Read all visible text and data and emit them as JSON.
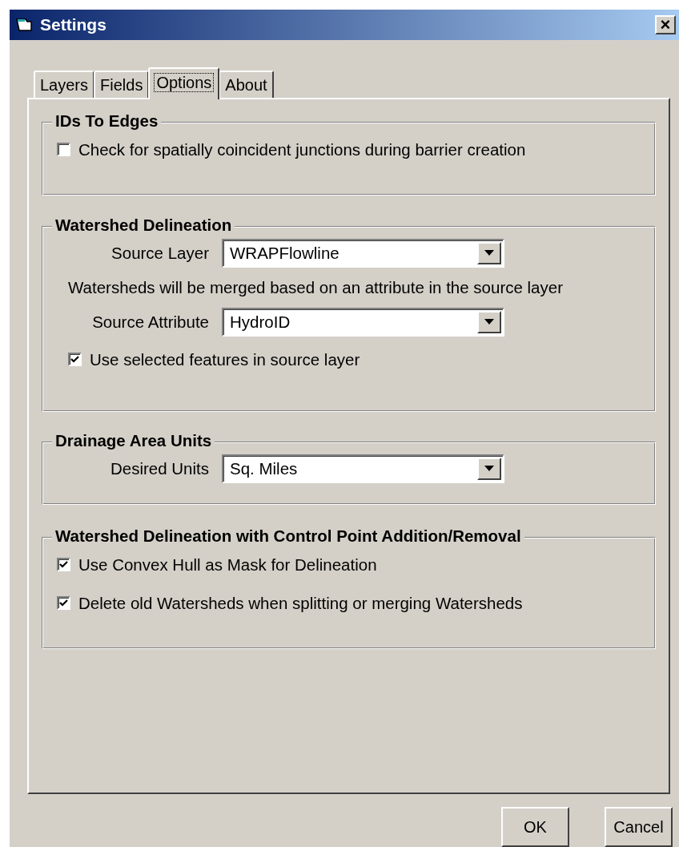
{
  "window": {
    "title": "Settings",
    "close": "×"
  },
  "tabs": [
    {
      "label": "Layers",
      "selected": false
    },
    {
      "label": "Fields",
      "selected": false
    },
    {
      "label": "Options",
      "selected": true
    },
    {
      "label": "About",
      "selected": false
    }
  ],
  "groups": [
    {
      "title": "IDs To Edges",
      "items": [
        {
          "kind": "check",
          "label": "Check for spatially coincident junctions during barrier creation",
          "checked": false
        }
      ]
    },
    {
      "title": "Watershed Delineation",
      "items": [
        {
          "kind": "combo",
          "label": "Source Layer",
          "value": "WRAPFlowline"
        },
        {
          "kind": "note",
          "label": "Watersheds will be merged based on an attribute in the source layer"
        },
        {
          "kind": "combo",
          "label": "Source Attribute",
          "value": "HydroID"
        },
        {
          "kind": "check",
          "label": "Use selected features in source layer",
          "checked": true
        }
      ]
    },
    {
      "title": "Drainage Area Units",
      "items": [
        {
          "kind": "combo",
          "label": "Desired Units",
          "value": "Sq. Miles"
        }
      ]
    },
    {
      "title": "Watershed Delineation with Control Point Addition/Removal",
      "items": [
        {
          "kind": "check",
          "label": "Use Convex Hull as Mask for Delineation",
          "checked": true
        },
        {
          "kind": "check",
          "label": "Delete old Watersheds when splitting or merging Watersheds",
          "checked": true
        }
      ]
    }
  ],
  "buttons": [
    "OK",
    "Cancel"
  ]
}
